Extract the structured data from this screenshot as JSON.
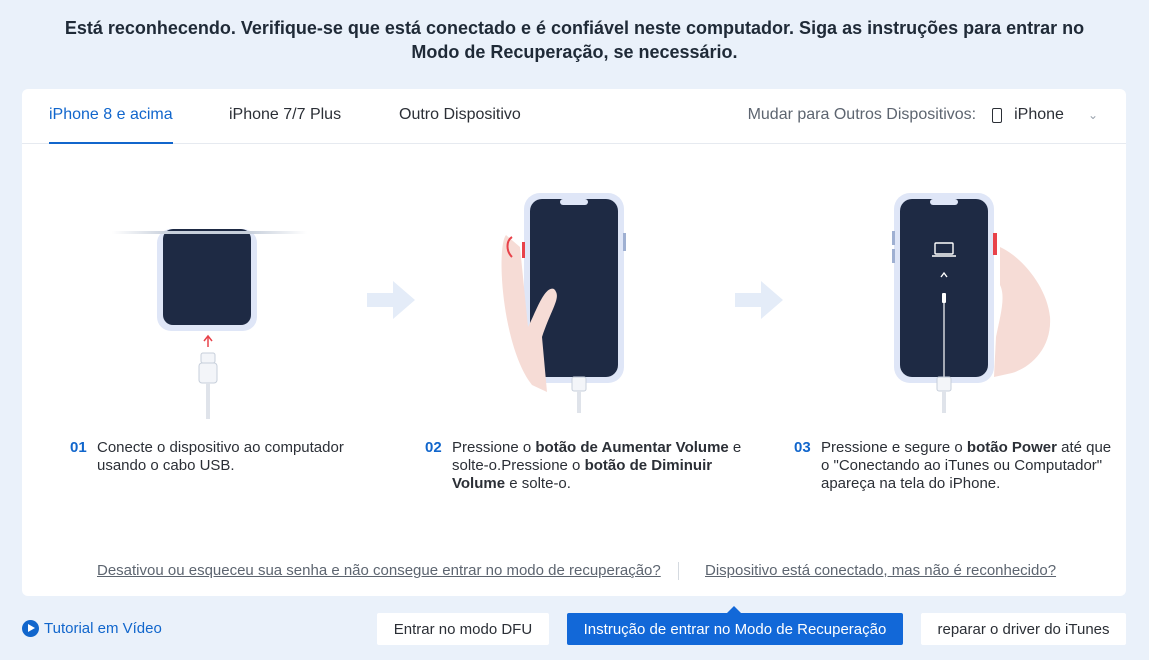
{
  "heading": "Está reconhecendo. Verifique-se que está conectado e é confiável neste computador. Siga as instruções para entrar no Modo de Recuperação, se necessário.",
  "tabs": [
    {
      "label": "iPhone 8 e acima",
      "active": true
    },
    {
      "label": "iPhone 7/7 Plus",
      "active": false
    },
    {
      "label": "Outro Dispositivo",
      "active": false
    }
  ],
  "switcher": {
    "label": "Mudar para Outros Dispositivos:",
    "value": "iPhone"
  },
  "steps": [
    {
      "num": "01",
      "parts": [
        {
          "t": "Conecte o dispositivo ao computador usando o cabo USB.",
          "b": false
        }
      ]
    },
    {
      "num": "02",
      "parts": [
        {
          "t": "Pressione o ",
          "b": false
        },
        {
          "t": "botão de Aumentar Volume",
          "b": true
        },
        {
          "t": " e solte-o.Pressione o ",
          "b": false
        },
        {
          "t": "botão de Diminuir Volume",
          "b": true
        },
        {
          "t": " e solte-o.",
          "b": false
        }
      ]
    },
    {
      "num": "03",
      "parts": [
        {
          "t": "Pressione e segure o ",
          "b": false
        },
        {
          "t": "botão Power",
          "b": true
        },
        {
          "t": " até que o \"Conectando ao iTunes ou Computador\" apareça na tela do iPhone.",
          "b": false
        }
      ]
    }
  ],
  "links": {
    "forgot_password": "Desativou ou esqueceu sua senha e não consegue entrar no modo de recuperação?",
    "not_recognized": "Dispositivo está conectado, mas não é reconhecido?"
  },
  "footer": {
    "tutorial": "Tutorial em Vídeo",
    "dfu_button": "Entrar no modo DFU",
    "recovery_button": "Instrução de entrar no Modo de Recuperação",
    "driver_button": "reparar o driver do iTunes"
  },
  "colors": {
    "accent": "#1166cc",
    "background": "#eaf1fa",
    "phone_screen": "#1e2a44",
    "phone_frame": "#dfe6f7",
    "button_highlight": "#e8424a"
  }
}
